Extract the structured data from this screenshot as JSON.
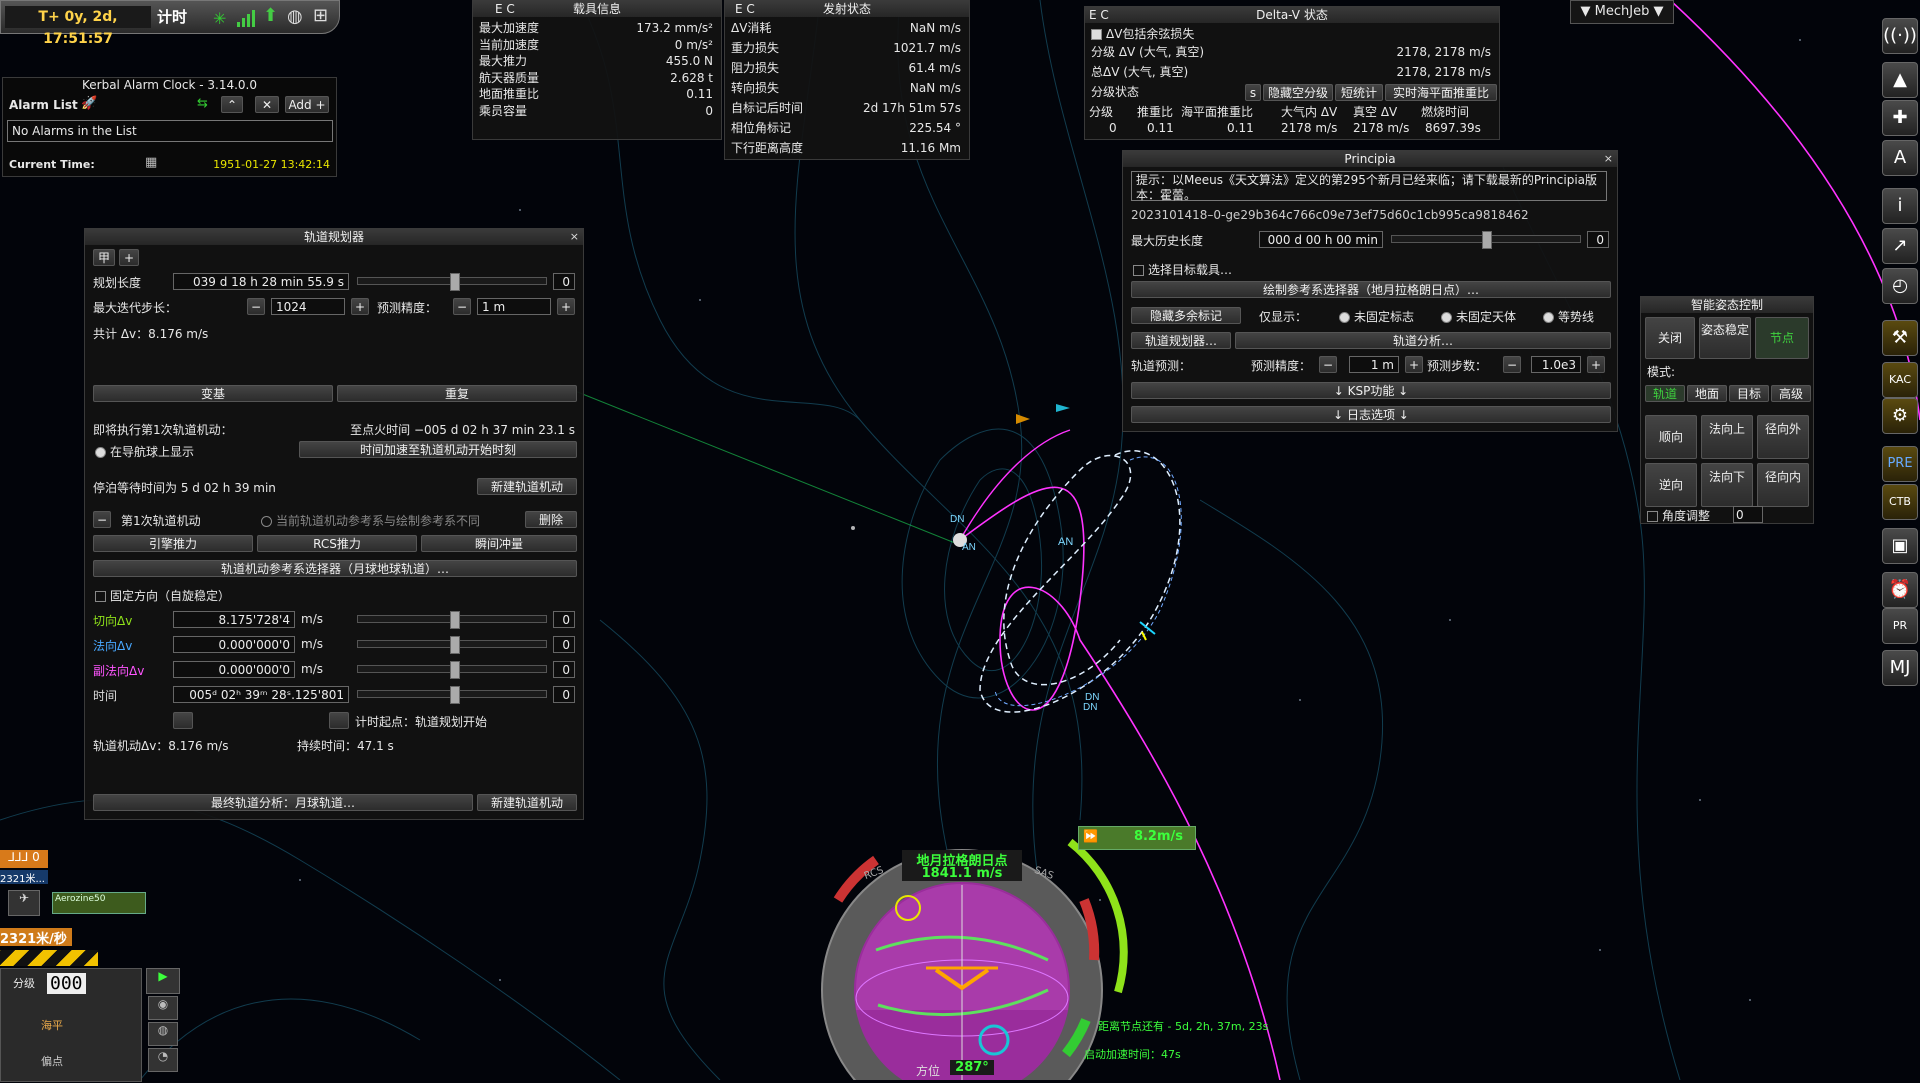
{
  "colors": {
    "accent_green": "#7cfc00",
    "orbit_magenta": "#ff33ff",
    "orbit_white": "#cfe6ff",
    "mj_green": "#3fd13f"
  },
  "top_clock": {
    "time": "T+ 0y, 2d, 17:51:57",
    "mode": "计时"
  },
  "alarm_clock": {
    "title": "Kerbal Alarm Clock - 3.14.0.0",
    "list_label": "Alarm List",
    "add_label": "Add",
    "empty_text": "No Alarms in the List",
    "current_time_label": "Current Time:",
    "current_time": "1951-01-27 13:42:14"
  },
  "vessel_info": {
    "ec": "E C",
    "title": "载具信息",
    "rows": [
      {
        "label": "最大加速度",
        "value": "173.2 mm/s²"
      },
      {
        "label": "当前加速度",
        "value": "0 m/s²"
      },
      {
        "label": "最大推力",
        "value": "455.0 N"
      },
      {
        "label": "航天器质量",
        "value": "2.628 t"
      },
      {
        "label": "地面推重比",
        "value": "0.11"
      },
      {
        "label": "乘员容量",
        "value": "0"
      }
    ]
  },
  "launch_status": {
    "ec": "E C",
    "title": "发射状态",
    "rows": [
      {
        "label": "ΔV消耗",
        "value": "NaN m/s"
      },
      {
        "label": "重力损失",
        "value": "1021.7 m/s"
      },
      {
        "label": "阻力损失",
        "value": "61.4 m/s"
      },
      {
        "label": "转向损失",
        "value": "NaN m/s"
      },
      {
        "label": "自标记后时间",
        "value": "2d 17h 51m 57s"
      },
      {
        "label": "相位角标记",
        "value": "225.54 °"
      },
      {
        "label": "下行距离高度",
        "value": "11.16 Mm"
      }
    ]
  },
  "deltav": {
    "ec": "E C",
    "title": "Delta-V 状态",
    "include_label": "ΔV包括余弦损失",
    "stage_dv_label": "分级 ΔV (大气, 真空)",
    "stage_dv_value": "2178, 2178 m/s",
    "total_dv_label": "总ΔV (大气, 真空)",
    "total_dv_value": "2178, 2178 m/s",
    "stage_status_label": "分级状态",
    "btn_s": "s",
    "btn_hide": "隐藏空分级",
    "btn_short": "短统计",
    "btn_sea": "实时海平面推重比",
    "headers": [
      "分级",
      "推重比",
      "海平面推重比",
      "大气内 ΔV",
      "真空 ΔV",
      "燃烧时间"
    ],
    "values": [
      "0",
      "0.11",
      "0.11",
      "2178 m/s",
      "2178 m/s",
      "8697.39s"
    ]
  },
  "principia": {
    "title": "Principia",
    "notice": "提示：以Meeus《天文算法》定义的第295个新月已经来临；请下载最新的Principia版本：霍蕾。",
    "version": "2023101418–0-ge29b364c766c09e73ef75d60c1cb995ca9818462",
    "history_label": "最大历史长度",
    "history_value": "000 d 00 h 00 min",
    "history_right": "0",
    "select_target": "选择目标载具…",
    "frame_selector": "绘制参考系选择器（地月拉格朗日点）…",
    "hide_markers": "隐藏多余标记",
    "only_show": "仅显示：",
    "opt1": "未固定标志",
    "opt2": "未固定天体",
    "opt3": "等势线",
    "planner_btn": "轨道规划器…",
    "analysis_btn": "轨道分析…",
    "prediction_label": "轨道预测：",
    "prediction_precision_label": "预测精度：",
    "prediction_precision": "1 m",
    "prediction_steps_label": "预测步数：",
    "prediction_steps": "1.0e3",
    "ksp_features": "↓ KSP功能 ↓",
    "log_options": "↓ 日志选项 ↓"
  },
  "planner": {
    "title": "轨道规划器",
    "tab1": "甲",
    "tab2": "+",
    "plan_length_label": "规划长度",
    "plan_length": "039 d 18 h 28 min 55.9 s",
    "plan_length_r": "0",
    "max_step_label": "最大迭代步长：",
    "max_step": "1024",
    "precision_label": "预测精度：",
    "precision": "1 m",
    "total_dv": "共计 Δv：8.176 m/s",
    "rebase": "变基",
    "repeat": "重复",
    "next_burn_label": "即将执行第1次轨道机动：",
    "next_burn_time": "至点火时间 −005 d 02 h 37 min 23.1 s",
    "show_navball": "在导航球上显示",
    "warp_btn": "时间加速至轨道机动开始时刻",
    "coast_label": "停泊等待时间为 5 d 02 h 39 min",
    "new_burn": "新建轨道机动",
    "burn1_label": "第1次轨道机动",
    "burn1_frame_note": "当前轨道机动参考系与绘制参考系不同",
    "delete": "删除",
    "engine": "引擎推力",
    "rcs": "RCS推力",
    "impulse": "瞬间冲量",
    "frame_selector": "轨道机动参考系选择器（月球地球轨道）…",
    "fixed_dir": "固定方向（自旋稳定）",
    "tangent_label": "切向Δv",
    "tangent_val": "8.175'728'4",
    "tangent_unit": "m/s",
    "normal_label": "法向Δv",
    "normal_val": "0.000'000'0",
    "normal_unit": "m/s",
    "binormal_label": "副法向Δv",
    "binormal_val": "0.000'000'0",
    "binormal_unit": "m/s",
    "time_label": "时间",
    "time_val": "005ᵈ 02ʰ 39ᵐ 28ˢ.125'801",
    "timer_origin": "计时起点：轨道规划开始",
    "burn_dv": "轨道机动Δv：8.176 m/s",
    "duration": "持续时间：47.1 s",
    "final_analysis": "最终轨道分析：月球轨道…",
    "new_burn2": "新建轨道机动",
    "zero": "0"
  },
  "smartass": {
    "title": "智能姿态控制",
    "off": "关闭",
    "kill": "姿态稳定",
    "node": "节点",
    "mode_label": "模式:",
    "modes": [
      "轨道",
      "地面",
      "目标",
      "高级"
    ],
    "pro": "顺向",
    "nup": "法向上",
    "rout": "径向外",
    "retro": "逆向",
    "ndn": "法向下",
    "rin": "径向内",
    "angle_label": "角度调整",
    "angle": "0"
  },
  "mechjeb_tab": "▼ MechJeb ▼",
  "navball": {
    "ref_line1": "地月拉格朗日点",
    "speed": "1841.1 m/s",
    "heading_label": "方位",
    "heading": "287°",
    "rcs": "RCS",
    "sas": "SAS",
    "burn_dv": "8.2m/s",
    "node_time": "距离节点还有 - 5d, 2h, 37m, 23s",
    "burn_time": "启动加速时间：47s"
  },
  "left_hud": {
    "speed_top": "2321米...",
    "fuel_label": "Aerozine50",
    "speed": "2321米/秒",
    "stage": "分级",
    "stage_num": "000",
    "alt_label": "海平",
    "orbit_label": "偏点"
  },
  "map_markers": {
    "dn1": "DN",
    "an1": "AN",
    "an2": "AN",
    "dn2": "DN",
    "dn3": "DN"
  },
  "toolbar_icons": [
    "antenna-icon",
    "fuel-icon",
    "tools-icon",
    "kerbal-icon",
    "info-icon",
    "wrench-icon",
    "clock-icon",
    "engineer-icon",
    "kac-icon",
    "graph-icon",
    "pre-icon",
    "ctb-icon",
    "planner-icon",
    "alarm-icon",
    "principia-icon",
    "mechjeb-icon"
  ]
}
